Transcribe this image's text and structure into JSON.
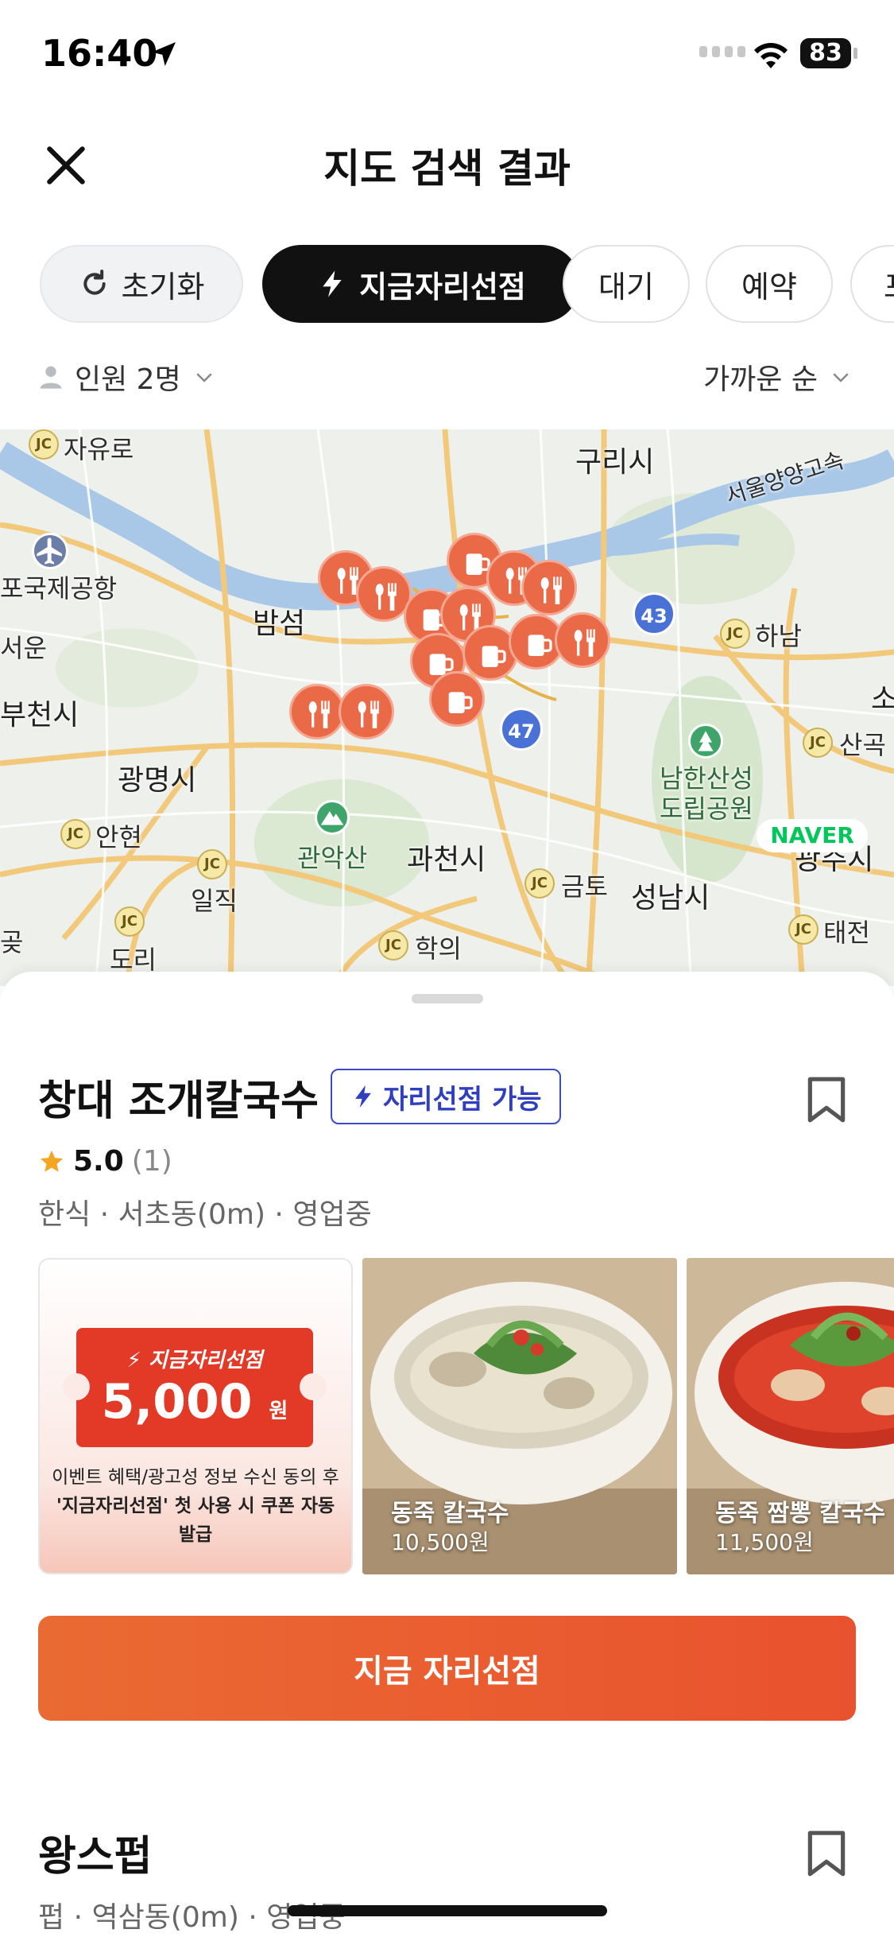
{
  "status_bar": {
    "time": "16:40",
    "battery": "83"
  },
  "header": {
    "title": "지도 검색 결과"
  },
  "filters": {
    "reset": "초기화",
    "now_seat": "지금자리선점",
    "wait": "대기",
    "reservation": "예약",
    "more_partial": "포"
  },
  "options": {
    "people": "인원 2명",
    "sort": "가까운 순"
  },
  "map": {
    "labels": {
      "jayuro": "자유로",
      "guri": "구리시",
      "seoul_yangyang": "서울양양고속",
      "gimpo_airport": "포국제공항",
      "bamseom": "밤섬",
      "seoul": "서운",
      "bucheon": "부천시",
      "hanam": "하남",
      "sangok": "산곡",
      "namhansanseong": "남한산성\n도립공원",
      "gwangmyeong": "광명시",
      "anhyeon": "안현",
      "gwanaksan": "관악산",
      "gwacheon": "과천시",
      "geumto": "금토",
      "seongnam": "성남시",
      "gwangju_partial": "광주시",
      "iljik": "일직",
      "dori": "도리",
      "hagui": "학의",
      "taejeon": "태전",
      "left_edge": "곶",
      "right_edge": "소"
    },
    "jc": "JC",
    "routes": [
      "43",
      "47"
    ],
    "provider": "NAVER"
  },
  "store1": {
    "name": "창대 조개칼국수",
    "badge": "자리선점 가능",
    "rating": "5.0",
    "review_count": "(1)",
    "meta": "한식 · 서초동(0m) · 영업중",
    "coupon": {
      "tag": "지금자리선점",
      "amount": "5,000",
      "unit": "원",
      "note_line1": "이벤트 혜택/광고성 정보 수신 동의 후",
      "note_line2": "'지금자리선점' 첫 사용 시 쿠폰 자동 발급"
    },
    "menus": [
      {
        "name": "동죽 칼국수",
        "price": "10,500원"
      },
      {
        "name": "동죽 짬뽕 칼국수",
        "price": "11,500원"
      }
    ],
    "cta": "지금 자리선점"
  },
  "store2": {
    "name": "왕스펍",
    "meta": "펍 · 역삼동(0m) · 영업중"
  },
  "colors": {
    "accent": "#ea5a2e",
    "pin": "#ea6a48",
    "badge_blue": "#2f3fbf"
  }
}
